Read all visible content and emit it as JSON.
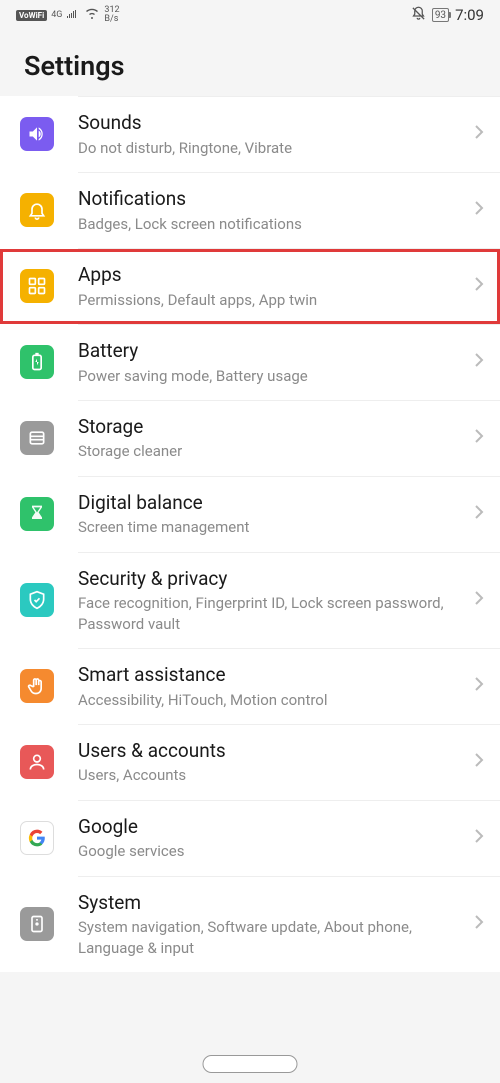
{
  "status": {
    "vowifi": "VoWiFi",
    "network": "4G",
    "data_rate": "312",
    "data_unit": "B/s",
    "battery": "93",
    "time": "7:09"
  },
  "header": {
    "title": "Settings"
  },
  "items": [
    {
      "id": "sounds",
      "title": "Sounds",
      "sub": "Do not disturb, Ringtone, Vibrate",
      "color": "#7b5cf0",
      "icon": "sound",
      "highlighted": false
    },
    {
      "id": "notifications",
      "title": "Notifications",
      "sub": "Badges, Lock screen notifications",
      "color": "#f5b100",
      "icon": "bell",
      "highlighted": false
    },
    {
      "id": "apps",
      "title": "Apps",
      "sub": "Permissions, Default apps, App twin",
      "color": "#f5b100",
      "icon": "grid",
      "highlighted": true
    },
    {
      "id": "battery",
      "title": "Battery",
      "sub": "Power saving mode, Battery usage",
      "color": "#2fc26b",
      "icon": "battery",
      "highlighted": false
    },
    {
      "id": "storage",
      "title": "Storage",
      "sub": "Storage cleaner",
      "color": "#9a9a9a",
      "icon": "storage",
      "highlighted": false
    },
    {
      "id": "digital",
      "title": "Digital balance",
      "sub": "Screen time management",
      "color": "#2fc26b",
      "icon": "hourglass",
      "highlighted": false
    },
    {
      "id": "security",
      "title": "Security & privacy",
      "sub": "Face recognition, Fingerprint ID, Lock screen password, Password vault",
      "color": "#2bc9c0",
      "icon": "shield",
      "highlighted": false
    },
    {
      "id": "smart",
      "title": "Smart assistance",
      "sub": "Accessibility, HiTouch, Motion control",
      "color": "#f58a2f",
      "icon": "hand",
      "highlighted": false
    },
    {
      "id": "users",
      "title": "Users & accounts",
      "sub": "Users, Accounts",
      "color": "#e85858",
      "icon": "user",
      "highlighted": false
    },
    {
      "id": "google",
      "title": "Google",
      "sub": "Google services",
      "color": "#ffffff",
      "icon": "google",
      "highlighted": false
    },
    {
      "id": "system",
      "title": "System",
      "sub": "System navigation, Software update, About phone, Language & input",
      "color": "#9a9a9a",
      "icon": "system",
      "highlighted": false
    }
  ]
}
